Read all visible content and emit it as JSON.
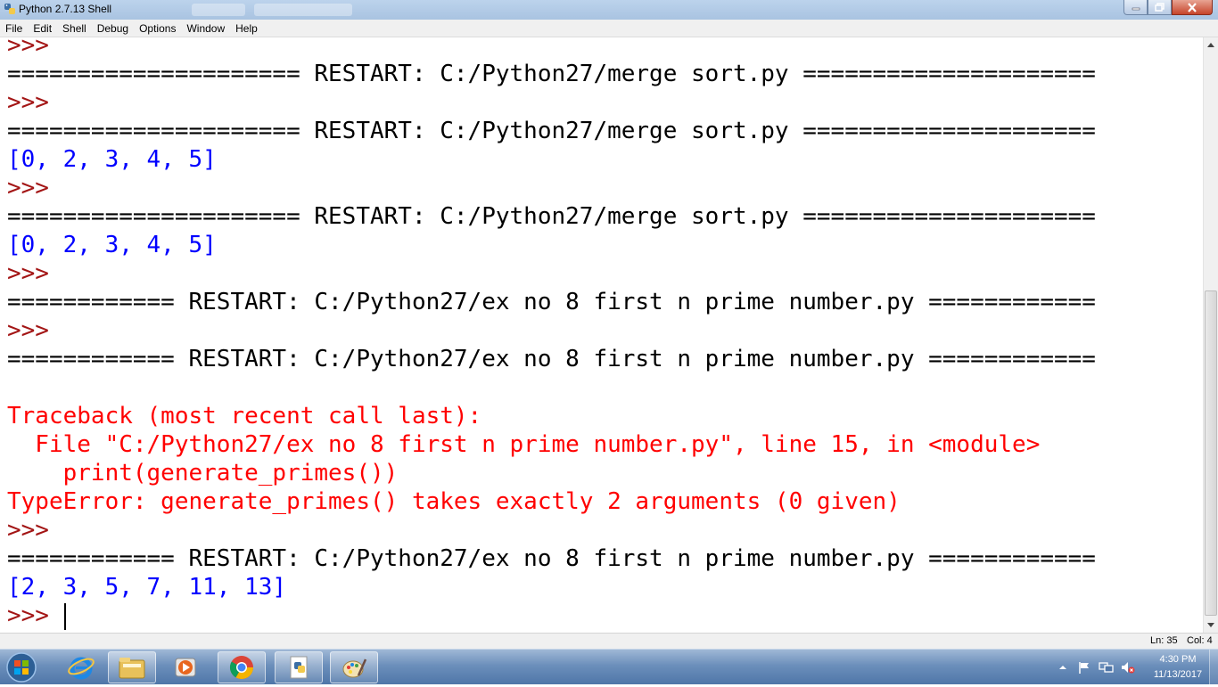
{
  "window": {
    "title": "Python 2.7.13 Shell"
  },
  "menu": [
    "File",
    "Edit",
    "Shell",
    "Debug",
    "Options",
    "Window",
    "Help"
  ],
  "shell_lines": [
    {
      "kind": "prompt",
      "text": ">>>"
    },
    {
      "kind": "restart",
      "text": "===================== RESTART: C:/Python27/merge sort.py ====================="
    },
    {
      "kind": "prompt",
      "text": ">>>"
    },
    {
      "kind": "restart",
      "text": "===================== RESTART: C:/Python27/merge sort.py ====================="
    },
    {
      "kind": "output",
      "text": "[0, 2, 3, 4, 5]"
    },
    {
      "kind": "prompt",
      "text": ">>>"
    },
    {
      "kind": "restart",
      "text": "===================== RESTART: C:/Python27/merge sort.py ====================="
    },
    {
      "kind": "output",
      "text": "[0, 2, 3, 4, 5]"
    },
    {
      "kind": "prompt",
      "text": ">>>"
    },
    {
      "kind": "restart",
      "text": "============ RESTART: C:/Python27/ex no 8 first n prime number.py ============"
    },
    {
      "kind": "prompt",
      "text": ">>>"
    },
    {
      "kind": "restart",
      "text": "============ RESTART: C:/Python27/ex no 8 first n prime number.py ============"
    },
    {
      "kind": "blank",
      "text": ""
    },
    {
      "kind": "error",
      "text": "Traceback (most recent call last):"
    },
    {
      "kind": "error",
      "text": "  File \"C:/Python27/ex no 8 first n prime number.py\", line 15, in <module>"
    },
    {
      "kind": "error",
      "text": "    print(generate_primes())"
    },
    {
      "kind": "error",
      "text": "TypeError: generate_primes() takes exactly 2 arguments (0 given)"
    },
    {
      "kind": "prompt",
      "text": ">>>"
    },
    {
      "kind": "restart",
      "text": "============ RESTART: C:/Python27/ex no 8 first n prime number.py ============"
    },
    {
      "kind": "output",
      "text": "[2, 3, 5, 7, 11, 13]"
    },
    {
      "kind": "prompt",
      "text": ">>> "
    }
  ],
  "status": {
    "line": "Ln: 35",
    "col": "Col: 4"
  },
  "taskbar": {
    "apps": [
      "start-orb-icon",
      "internet-explorer-icon",
      "file-explorer-icon",
      "media-player-icon",
      "chrome-icon",
      "python-file-icon",
      "paint-icon"
    ],
    "tray_icons": [
      "show-hidden-icons-icon",
      "action-center-flag-icon",
      "network-icon",
      "volume-muted-icon"
    ],
    "clock_time": "4:30 PM",
    "clock_date": "11/13/2017"
  },
  "colors": {
    "prompt": "#a31515",
    "output": "#0000ff",
    "error": "#ff0000",
    "restart": "#000000"
  }
}
